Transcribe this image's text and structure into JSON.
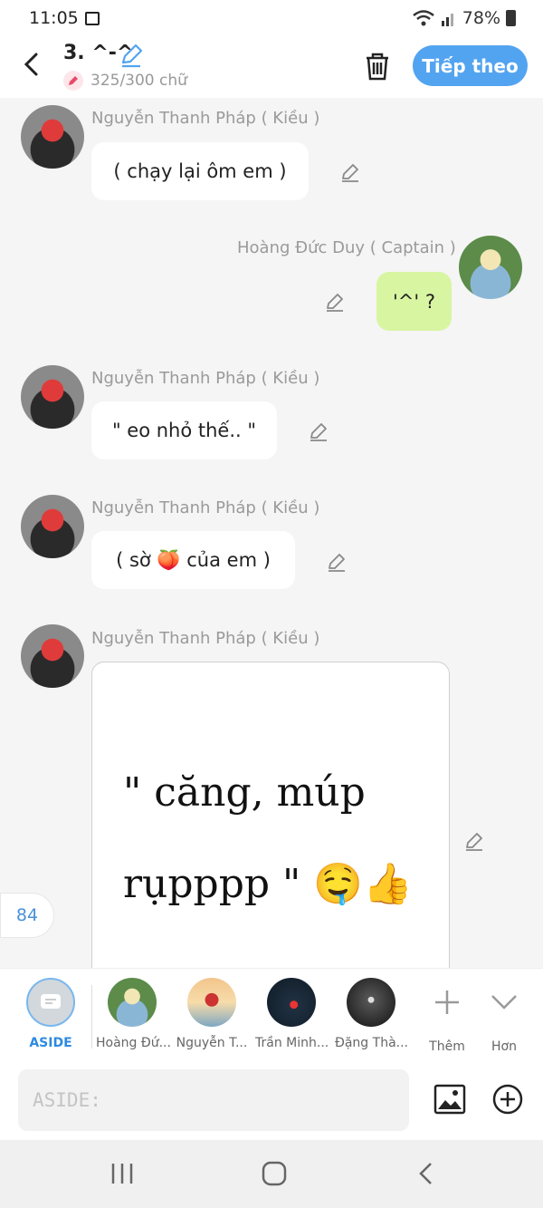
{
  "status_bar": {
    "time": "11:05",
    "battery": "78%"
  },
  "header": {
    "title": "3. ^-^",
    "char_count": "325/300 chữ",
    "next_label": "Tiếp theo"
  },
  "messages": [
    {
      "sender": "Nguyễn Thanh Pháp ( Kiều )",
      "text": "( chạy lại ôm em )",
      "side": "left"
    },
    {
      "sender": "Hoàng Đức Duy ( Captain )",
      "text": "'^' ?",
      "side": "right"
    },
    {
      "sender": "Nguyễn Thanh Pháp ( Kiều )",
      "text": "\" eo nhỏ thế.. \"",
      "side": "left"
    },
    {
      "sender": "Nguyễn Thanh Pháp ( Kiều )",
      "text": "( sờ 🍑 của em )",
      "side": "left"
    },
    {
      "sender": "Nguyễn Thanh Pháp ( Kiều )",
      "image_text_line1": "\" căng, múp",
      "image_text_line2": "rụpppp \" 🤤👍",
      "side": "left"
    }
  ],
  "unread_badge": "84",
  "characters": [
    {
      "label": "ASIDE",
      "selected": true
    },
    {
      "label": "Hoàng Đứ..."
    },
    {
      "label": "Nguyễn T..."
    },
    {
      "label": "Trần Minh..."
    },
    {
      "label": "Đặng Thà..."
    }
  ],
  "more": {
    "add_label": "Thêm",
    "collapse_label": "Hơn"
  },
  "input": {
    "placeholder": "ASIDE:"
  },
  "colors": {
    "accent": "#53a4f0",
    "green_bubble": "#d8f5a2"
  }
}
